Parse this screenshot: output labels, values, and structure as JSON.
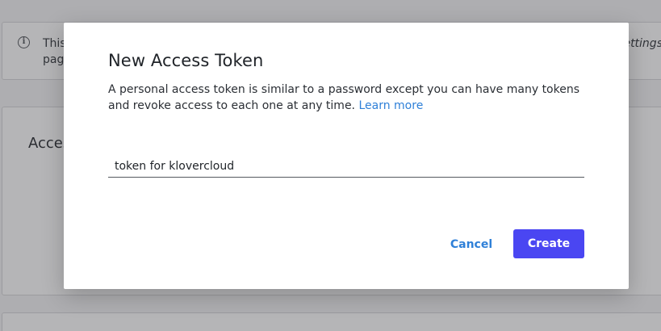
{
  "background": {
    "banner": {
      "icon": "info-icon",
      "text": "This",
      "text_line2": "page",
      "link_text": "settings"
    },
    "access_card": {
      "heading": "Acces"
    }
  },
  "modal": {
    "title": "New Access Token",
    "description": "A personal access token is similar to a password except you can have many tokens and revoke access to each one at any time.",
    "learn_more": "Learn more",
    "token_input": {
      "value": "token for klovercloud",
      "placeholder": ""
    },
    "cancel_label": "Cancel",
    "create_label": "Create"
  },
  "colors": {
    "primary_button": "#4a46f2",
    "link": "#2f80d8",
    "overlay": "rgba(60,60,66,0.38)"
  }
}
